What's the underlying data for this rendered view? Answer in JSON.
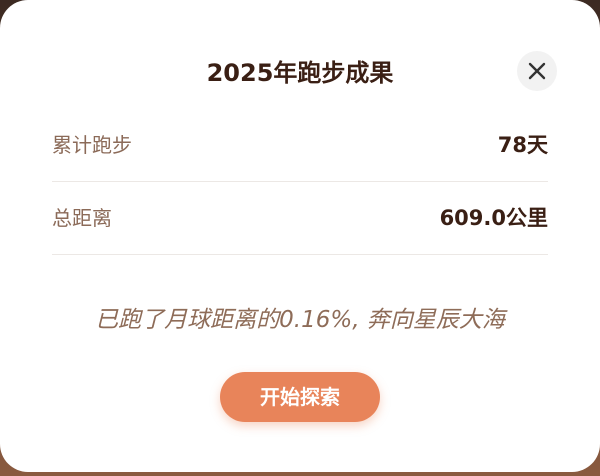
{
  "dialog": {
    "title": "2025年跑步成果",
    "close_icon": "close-icon",
    "stats": [
      {
        "label": "累计跑步",
        "value": "78天"
      },
      {
        "label": "总距离",
        "value": "609.0公里"
      }
    ],
    "message": "已跑了月球距离的0.16%, 奔向星辰大海",
    "explore_button": "开始探索"
  },
  "colors": {
    "title": "#3a1f14",
    "label": "#8b6a58",
    "message": "#8e6c58",
    "button": "#e8845a",
    "close_bg": "#f2f2f2"
  }
}
